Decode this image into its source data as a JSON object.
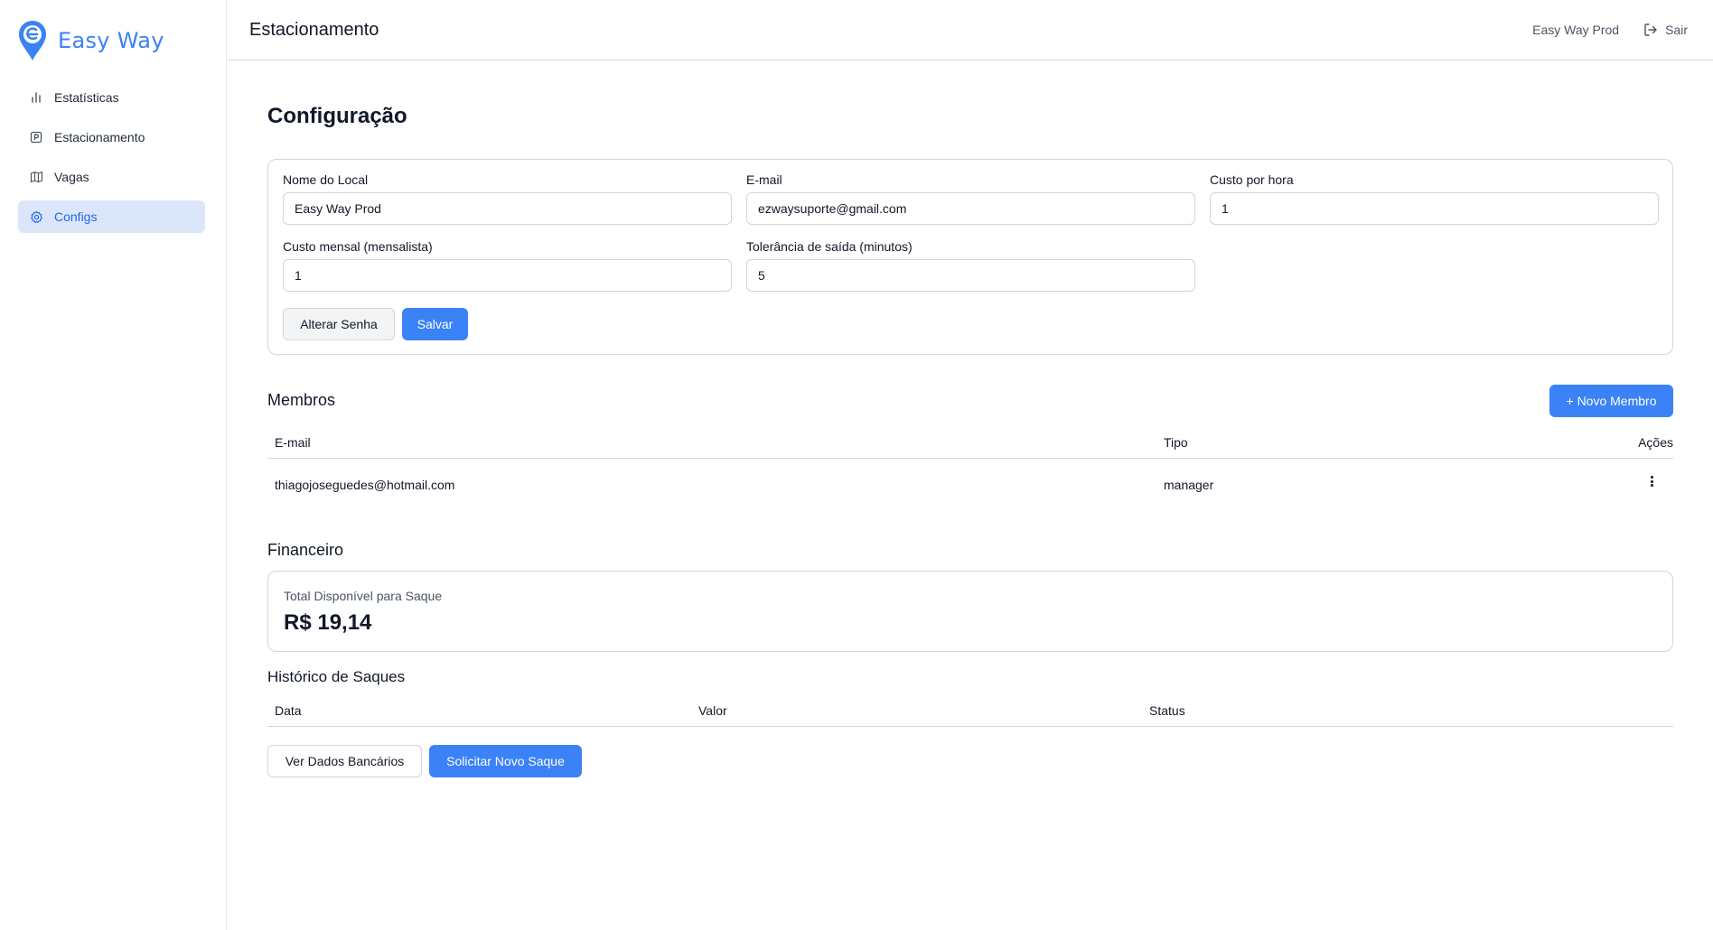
{
  "app": {
    "name": "Easy Way",
    "brand_color": "#3b82f6"
  },
  "sidebar": {
    "items": [
      {
        "label": "Estatísticas",
        "icon": "bar-chart-icon"
      },
      {
        "label": "Estacionamento",
        "icon": "parking-icon"
      },
      {
        "label": "Vagas",
        "icon": "map-icon"
      },
      {
        "label": "Configs",
        "icon": "gear-icon",
        "active": true
      }
    ]
  },
  "header": {
    "title": "Estacionamento",
    "user": "Easy Way Prod",
    "logout": "Sair"
  },
  "page": {
    "title": "Configuração"
  },
  "config": {
    "nome": {
      "label": "Nome do Local",
      "value": "Easy Way Prod"
    },
    "email": {
      "label": "E-mail",
      "value": "ezwaysuporte@gmail.com"
    },
    "custo_hora": {
      "label": "Custo por hora",
      "value": "1"
    },
    "custo_mensal": {
      "label": "Custo mensal (mensalista)",
      "value": "1"
    },
    "tolerancia": {
      "label": "Tolerância de saída (minutos)",
      "value": "5"
    },
    "alterar_senha": "Alterar Senha",
    "salvar": "Salvar"
  },
  "membros": {
    "title": "Membros",
    "novo_button": "+ Novo Membro",
    "columns": [
      "E-mail",
      "Tipo",
      "Ações"
    ],
    "rows": [
      {
        "email": "thiagojoseguedes@hotmail.com",
        "tipo": "manager"
      }
    ]
  },
  "financeiro": {
    "title": "Financeiro",
    "total_label": "Total Disponível para Saque",
    "total_value": "R$ 19,14"
  },
  "historico": {
    "title": "Histórico de Saques",
    "columns": [
      "Data",
      "Valor",
      "Status"
    ],
    "ver_dados": "Ver Dados Bancários",
    "solicitar": "Solicitar Novo Saque"
  }
}
